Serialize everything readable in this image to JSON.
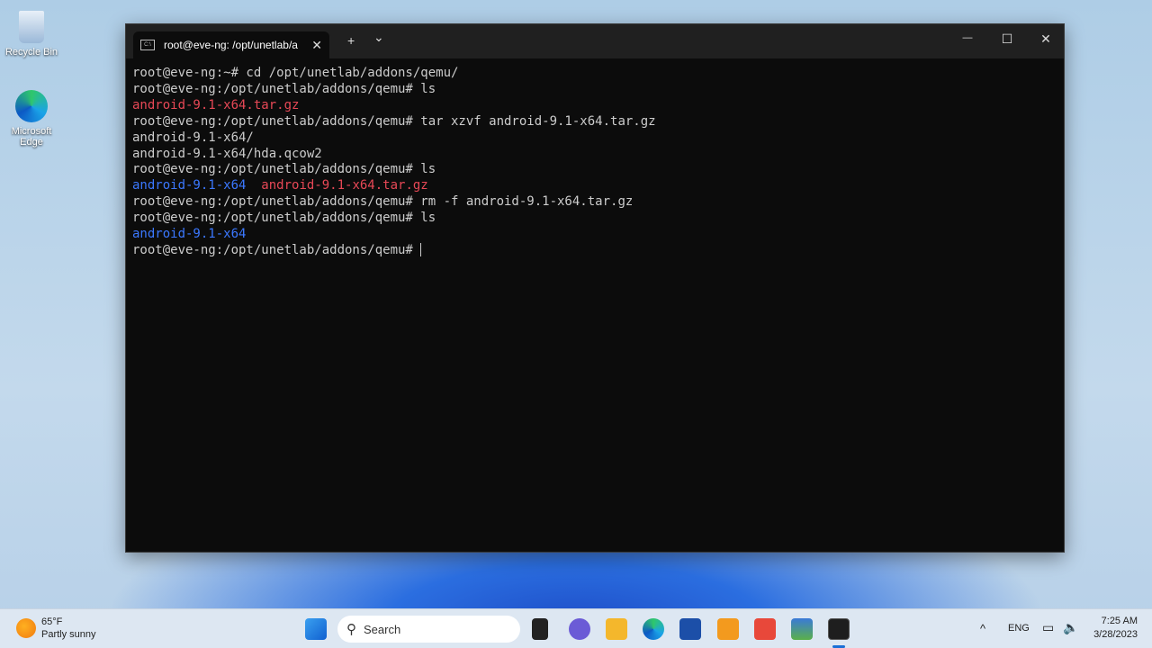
{
  "desktop": {
    "icons": [
      {
        "label": "Recycle Bin",
        "icon": "recycle-bin-icon"
      },
      {
        "label": "Microsoft Edge",
        "icon": "edge-icon"
      }
    ]
  },
  "window": {
    "tab_title": "root@eve-ng: /opt/unetlab/a",
    "new_tab": "+",
    "dropdown": "⌄",
    "minimize": "—",
    "maximize": "☐",
    "close": "✕"
  },
  "terminal": {
    "lines": [
      [
        {
          "t": "root@eve-ng:~# cd /opt/unetlab/addons/qemu/",
          "c": ""
        }
      ],
      [
        {
          "t": "root@eve-ng:/opt/unetlab/addons/qemu# ls",
          "c": ""
        }
      ],
      [
        {
          "t": "android-9.1-x64.tar.gz",
          "c": "red"
        }
      ],
      [
        {
          "t": "root@eve-ng:/opt/unetlab/addons/qemu# tar xzvf android-9.1-x64.tar.gz",
          "c": ""
        }
      ],
      [
        {
          "t": "android-9.1-x64/",
          "c": ""
        }
      ],
      [
        {
          "t": "android-9.1-x64/hda.qcow2",
          "c": ""
        }
      ],
      [
        {
          "t": "root@eve-ng:/opt/unetlab/addons/qemu# ls",
          "c": ""
        }
      ],
      [
        {
          "t": "android-9.1-x64",
          "c": "blue"
        },
        {
          "t": "  ",
          "c": ""
        },
        {
          "t": "android-9.1-x64.tar.gz",
          "c": "red"
        }
      ],
      [
        {
          "t": "root@eve-ng:/opt/unetlab/addons/qemu# rm -f android-9.1-x64.tar.gz",
          "c": ""
        }
      ],
      [
        {
          "t": "root@eve-ng:/opt/unetlab/addons/qemu# ls",
          "c": ""
        }
      ],
      [
        {
          "t": "android-9.1-x64",
          "c": "blue"
        }
      ],
      [
        {
          "t": "root@eve-ng:/opt/unetlab/addons/qemu# ",
          "c": ""
        }
      ]
    ]
  },
  "taskbar": {
    "weather_temp": "65°F",
    "weather_desc": "Partly sunny",
    "search_placeholder": "Search",
    "lang": "ENG",
    "time": "7:25 AM",
    "date": "3/28/2023",
    "tray_chevron": "^"
  }
}
